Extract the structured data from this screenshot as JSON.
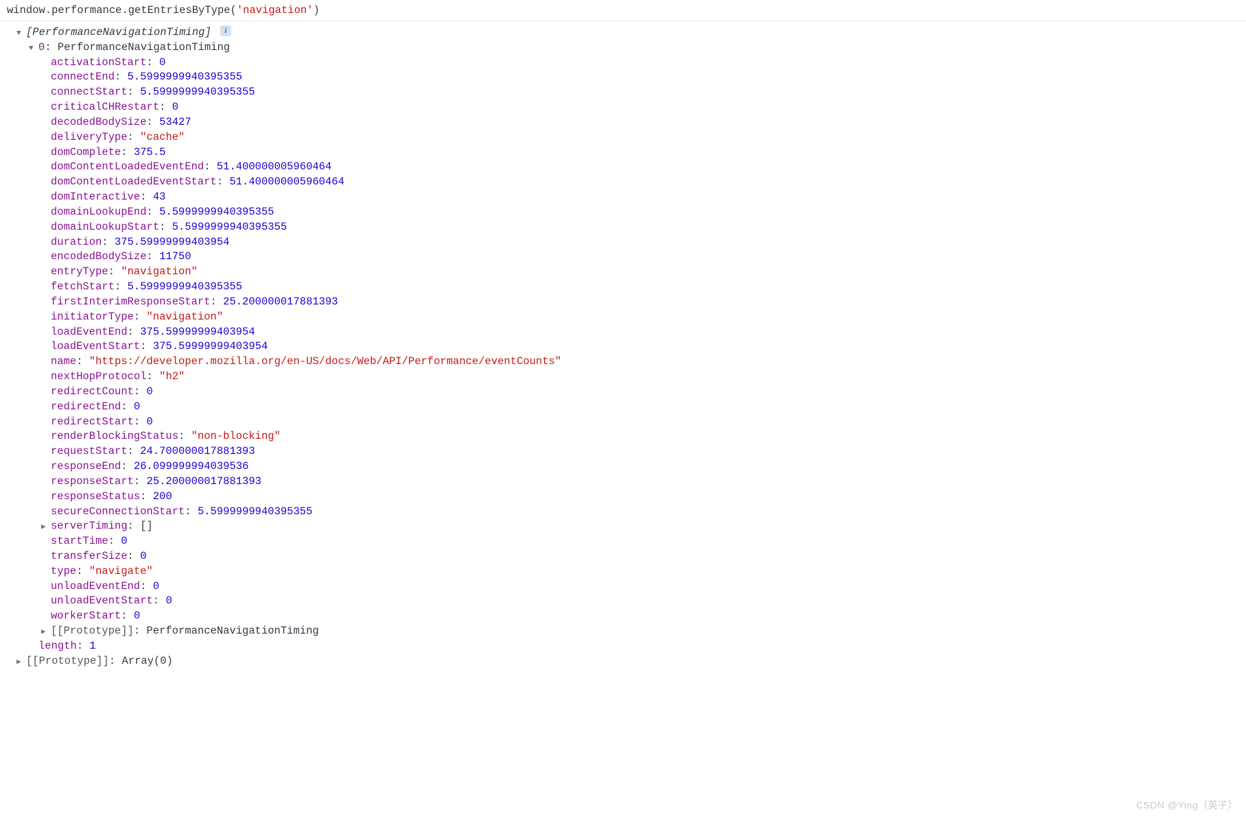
{
  "input": {
    "prefix": "window.performance.getEntriesByType(",
    "arg": "'navigation'",
    "suffix": ")"
  },
  "header": {
    "typeName": "[PerformanceNavigationTiming]",
    "info": "i"
  },
  "item0": {
    "label": "0",
    "typeName": "PerformanceNavigationTiming"
  },
  "props": [
    {
      "k": "activationStart",
      "t": "num",
      "v": "0"
    },
    {
      "k": "connectEnd",
      "t": "num",
      "v": "5.5999999940395355"
    },
    {
      "k": "connectStart",
      "t": "num",
      "v": "5.5999999940395355"
    },
    {
      "k": "criticalCHRestart",
      "t": "num",
      "v": "0"
    },
    {
      "k": "decodedBodySize",
      "t": "num",
      "v": "53427"
    },
    {
      "k": "deliveryType",
      "t": "str",
      "v": "\"cache\""
    },
    {
      "k": "domComplete",
      "t": "num",
      "v": "375.5"
    },
    {
      "k": "domContentLoadedEventEnd",
      "t": "num",
      "v": "51.400000005960464"
    },
    {
      "k": "domContentLoadedEventStart",
      "t": "num",
      "v": "51.400000005960464"
    },
    {
      "k": "domInteractive",
      "t": "num",
      "v": "43"
    },
    {
      "k": "domainLookupEnd",
      "t": "num",
      "v": "5.5999999940395355"
    },
    {
      "k": "domainLookupStart",
      "t": "num",
      "v": "5.5999999940395355"
    },
    {
      "k": "duration",
      "t": "num",
      "v": "375.59999999403954"
    },
    {
      "k": "encodedBodySize",
      "t": "num",
      "v": "11750"
    },
    {
      "k": "entryType",
      "t": "str",
      "v": "\"navigation\""
    },
    {
      "k": "fetchStart",
      "t": "num",
      "v": "5.5999999940395355"
    },
    {
      "k": "firstInterimResponseStart",
      "t": "num",
      "v": "25.200000017881393"
    },
    {
      "k": "initiatorType",
      "t": "str",
      "v": "\"navigation\""
    },
    {
      "k": "loadEventEnd",
      "t": "num",
      "v": "375.59999999403954"
    },
    {
      "k": "loadEventStart",
      "t": "num",
      "v": "375.59999999403954"
    },
    {
      "k": "name",
      "t": "str",
      "v": "\"https://developer.mozilla.org/en-US/docs/Web/API/Performance/eventCounts\""
    },
    {
      "k": "nextHopProtocol",
      "t": "str",
      "v": "\"h2\""
    },
    {
      "k": "redirectCount",
      "t": "num",
      "v": "0"
    },
    {
      "k": "redirectEnd",
      "t": "num",
      "v": "0"
    },
    {
      "k": "redirectStart",
      "t": "num",
      "v": "0"
    },
    {
      "k": "renderBlockingStatus",
      "t": "str",
      "v": "\"non-blocking\""
    },
    {
      "k": "requestStart",
      "t": "num",
      "v": "24.700000017881393"
    },
    {
      "k": "responseEnd",
      "t": "num",
      "v": "26.099999994039536"
    },
    {
      "k": "responseStart",
      "t": "num",
      "v": "25.200000017881393"
    },
    {
      "k": "responseStatus",
      "t": "num",
      "v": "200"
    },
    {
      "k": "secureConnectionStart",
      "t": "num",
      "v": "5.5999999940395355"
    },
    {
      "k": "serverTiming",
      "t": "arr",
      "v": "[]",
      "arrow": "right"
    },
    {
      "k": "startTime",
      "t": "num",
      "v": "0"
    },
    {
      "k": "transferSize",
      "t": "num",
      "v": "0"
    },
    {
      "k": "type",
      "t": "str",
      "v": "\"navigate\""
    },
    {
      "k": "unloadEventEnd",
      "t": "num",
      "v": "0"
    },
    {
      "k": "unloadEventStart",
      "t": "num",
      "v": "0"
    },
    {
      "k": "workerStart",
      "t": "num",
      "v": "0"
    },
    {
      "k": "[[Prototype]]",
      "t": "proto",
      "v": "PerformanceNavigationTiming",
      "arrow": "right"
    }
  ],
  "tail": {
    "lengthKey": "length",
    "lengthVal": "1",
    "protoKey": "[[Prototype]]",
    "protoVal": "Array(0)"
  },
  "watermark": "CSDN @Ying（英子）"
}
